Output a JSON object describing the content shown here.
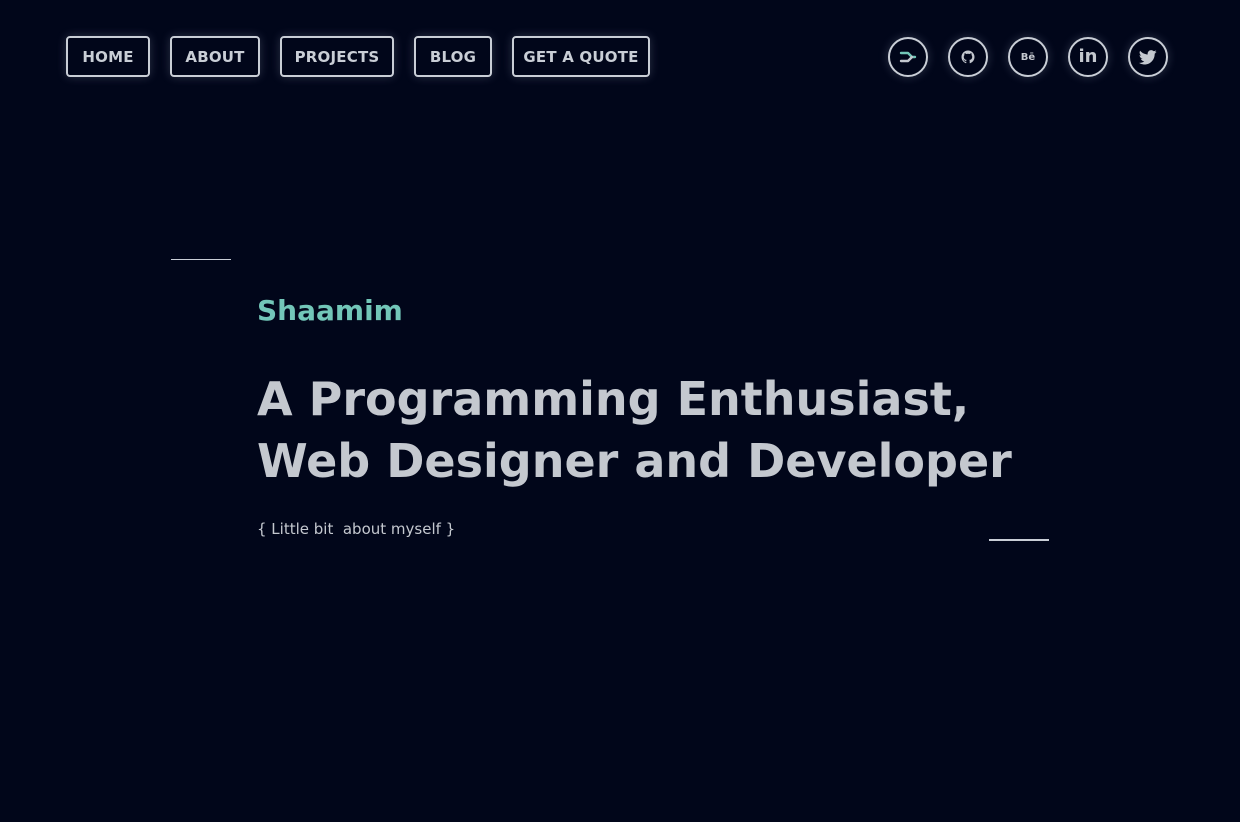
{
  "nav": {
    "items": [
      {
        "label": "HOME"
      },
      {
        "label": "ABOUT"
      },
      {
        "label": "PROJECTS"
      },
      {
        "label": "BLOG"
      },
      {
        "label": "GET A QUOTE"
      }
    ]
  },
  "social": {
    "icons": [
      "stackshare-icon",
      "github-icon",
      "behance-icon",
      "linkedin-icon",
      "twitter-icon"
    ],
    "behance_text": "Bē",
    "linkedin_text": "in"
  },
  "hero": {
    "name": "Shaamim",
    "headline_line1": "A Programming Enthusiast,",
    "headline_line2": "Web Designer and Developer",
    "subtitle": "{ Little bit  about myself }"
  },
  "colors": {
    "background": "#01061a",
    "accent": "#72c6b8",
    "text": "#c4c8cf",
    "border": "#c9ced6"
  }
}
